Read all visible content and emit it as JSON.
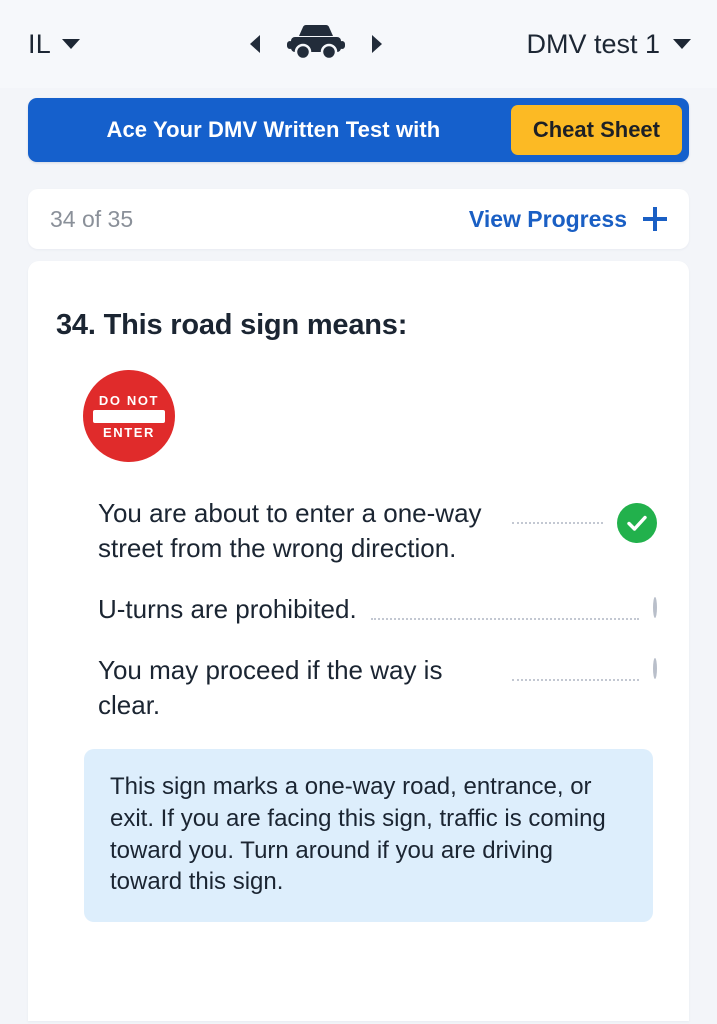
{
  "topbar": {
    "state_label": "IL",
    "state_caret_icon": "chevron-down-icon",
    "prev_icon": "chevron-left-icon",
    "vehicle_icon": "car-icon",
    "next_icon": "chevron-right-icon",
    "test_label": "DMV test 1",
    "test_caret_icon": "chevron-down-icon"
  },
  "promo": {
    "text": "Ace Your DMV Written Test with",
    "button_label": "Cheat Sheet",
    "bg_color": "#1560cc",
    "button_color": "#fcba24"
  },
  "progress": {
    "count_label": "34 of 35",
    "link_label": "View Progress",
    "plus_icon": "plus-icon",
    "link_color": "#1a5fc4"
  },
  "question": {
    "title": "34. This road sign means:",
    "sign": {
      "name": "do-not-enter-sign",
      "top_text": "DO NOT",
      "bottom_text": "ENTER",
      "color": "#e02b2b"
    },
    "answers": [
      {
        "text": "You are about to enter a one-way street from the wrong direction.",
        "state": "correct",
        "marker_icon": "check-circle-icon"
      },
      {
        "text": "U-turns are prohibited.",
        "state": "unselected",
        "marker_icon": "radio-empty-icon"
      },
      {
        "text": "You may proceed if the way is clear.",
        "state": "unselected",
        "marker_icon": "radio-empty-icon"
      }
    ],
    "explanation": "This sign marks a one-way road, entrance, or exit. If you are facing this sign, traffic is coming toward you. Turn around if you are driving toward this sign.",
    "explanation_bg": "#ddeefc",
    "correct_color": "#22b14c"
  }
}
